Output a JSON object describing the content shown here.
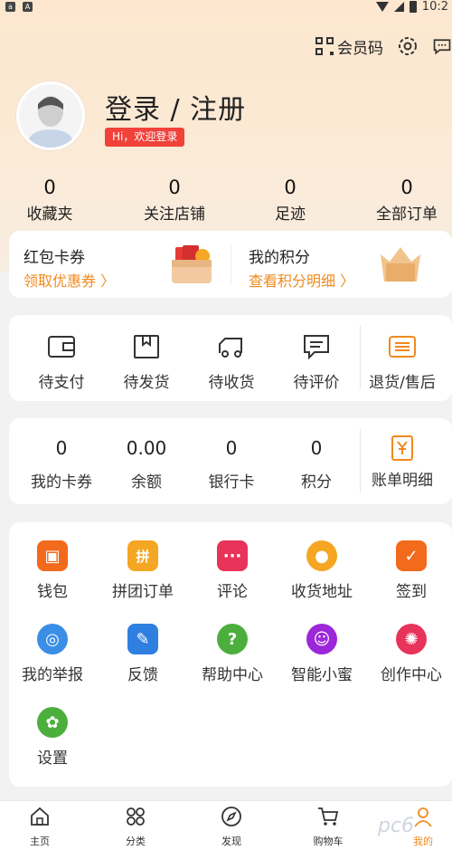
{
  "status_bar": {
    "time": "10:2",
    "icon_a": "a",
    "icon_b": "A"
  },
  "header": {
    "vip_code_label": "会员码",
    "login_title": "登录 / 注册",
    "welcome_text": "Hi，欢迎登录"
  },
  "stats": [
    {
      "value": "0",
      "label": "收藏夹"
    },
    {
      "value": "0",
      "label": "关注店铺"
    },
    {
      "value": "0",
      "label": "足迹"
    },
    {
      "value": "0",
      "label": "全部订单"
    }
  ],
  "promo": {
    "coupon_title": "红包卡券",
    "coupon_link": "领取优惠券 〉",
    "points_title": "我的积分",
    "points_link": "查看积分明细 〉"
  },
  "orders": [
    {
      "label": "待支付",
      "icon": "wallet-icon"
    },
    {
      "label": "待发货",
      "icon": "box-icon"
    },
    {
      "label": "待收货",
      "icon": "truck-icon"
    },
    {
      "label": "待评价",
      "icon": "comment-icon"
    },
    {
      "label": "退货/售后",
      "icon": "return-icon"
    }
  ],
  "assets": [
    {
      "value": "0",
      "label": "我的卡券"
    },
    {
      "value": "0.00",
      "label": "余额"
    },
    {
      "value": "0",
      "label": "银行卡"
    },
    {
      "value": "0",
      "label": "积分"
    },
    {
      "value": "",
      "label": "账单明细"
    }
  ],
  "services": [
    {
      "label": "钱包",
      "icon": "wallet-icon",
      "glyph": "▣"
    },
    {
      "label": "拼团订单",
      "icon": "group-order-icon",
      "glyph": "拼"
    },
    {
      "label": "评论",
      "icon": "review-icon",
      "glyph": "···"
    },
    {
      "label": "收货地址",
      "icon": "location-icon",
      "glyph": "●"
    },
    {
      "label": "签到",
      "icon": "checkin-icon",
      "glyph": "✓"
    },
    {
      "label": "我的举报",
      "icon": "report-icon",
      "glyph": "◎"
    },
    {
      "label": "反馈",
      "icon": "feedback-icon",
      "glyph": "✎"
    },
    {
      "label": "帮助中心",
      "icon": "help-icon",
      "glyph": "?"
    },
    {
      "label": "智能小蜜",
      "icon": "assistant-icon",
      "glyph": "☺"
    },
    {
      "label": "创作中心",
      "icon": "aperture-icon",
      "glyph": "✺"
    },
    {
      "label": "设置",
      "icon": "settings-icon",
      "glyph": "✿"
    }
  ],
  "colors": {
    "accent": "#f08a1e",
    "badge": "#f0413a",
    "wallet": "#f26a1b",
    "group": "#f5a623",
    "review": "#e8335a",
    "location": "#f5a623",
    "checkin": "#f26a1b",
    "report": "#3a8ee6",
    "feedback": "#2f7fe0",
    "help": "#4caf3d",
    "assistant": "#9b27d8",
    "aperture": "#e8335a",
    "settings": "#4caf3d"
  },
  "tabbar": [
    {
      "label": "主页",
      "icon": "home-icon"
    },
    {
      "label": "分类",
      "icon": "category-icon"
    },
    {
      "label": "发现",
      "icon": "compass-icon"
    },
    {
      "label": "购物车",
      "icon": "cart-icon"
    },
    {
      "label": "我的",
      "icon": "profile-icon"
    }
  ],
  "watermark": "pc6"
}
